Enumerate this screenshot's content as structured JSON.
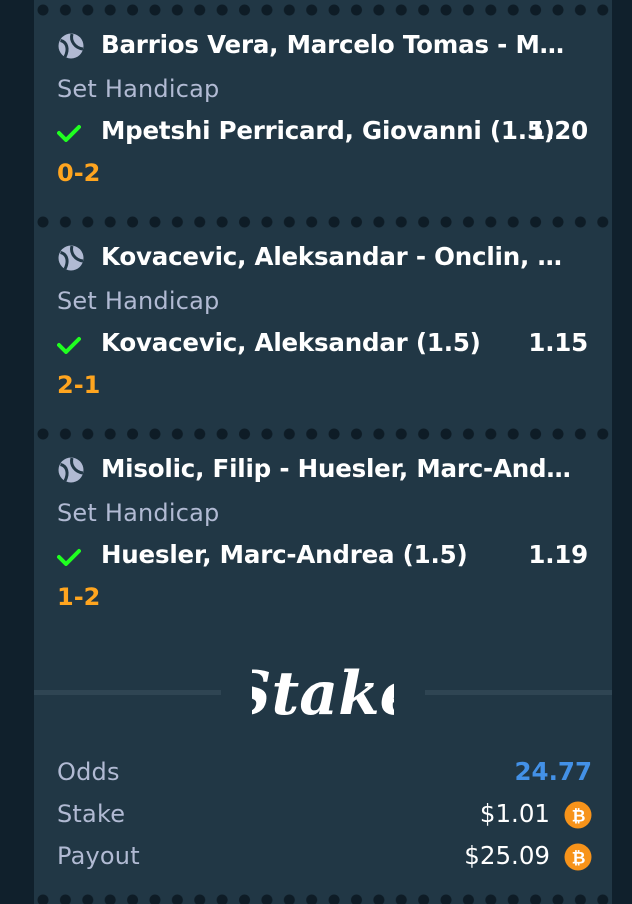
{
  "bets": [
    {
      "match": "Barrios Vera, Marcelo Tomas - Mpetshi Perricard, Giovanni",
      "market": "Set Handicap",
      "selection": "Mpetshi Perricard, Giovanni (1.5)",
      "odds": "1.20",
      "score": "0-2",
      "icon": "tennis-ball-icon",
      "status_icon": "check-icon"
    },
    {
      "match": "Kovacevic, Aleksandar - Onclin, Gauthier",
      "market": "Set Handicap",
      "selection": "Kovacevic, Aleksandar (1.5)",
      "odds": "1.15",
      "score": "2-1",
      "icon": "tennis-ball-icon",
      "status_icon": "check-icon"
    },
    {
      "match": "Misolic, Filip - Huesler, Marc-Andrea",
      "market": "Set Handicap",
      "selection": "Huesler, Marc-Andrea (1.5)",
      "odds": "1.19",
      "score": "1-2",
      "icon": "tennis-ball-icon",
      "status_icon": "check-icon"
    }
  ],
  "brand": {
    "logo_text": "Stake"
  },
  "summary": {
    "odds_label": "Odds",
    "odds_value": "24.77",
    "stake_label": "Stake",
    "stake_value": "$1.01",
    "payout_label": "Payout",
    "payout_value": "$25.09",
    "currency_icon": "bitcoin-icon"
  },
  "colors": {
    "background": "#10202c",
    "card": "#213745",
    "muted_text": "#b1bad3",
    "score": "#ffa51f",
    "odds_accent": "#4391e7",
    "check": "#1fff20",
    "coin": "#f7931a"
  }
}
